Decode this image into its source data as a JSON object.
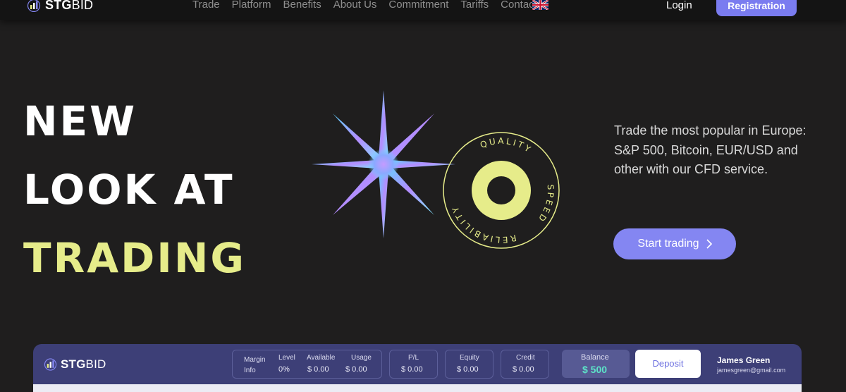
{
  "header": {
    "logo_text_bold": "STG",
    "logo_text_rest": "BID",
    "nav": [
      "Trade",
      "Platform",
      "Benefits",
      "About Us",
      "Commitment",
      "Tariffs",
      "Contacts"
    ],
    "login": "Login",
    "register": "Registration"
  },
  "hero": {
    "line1": "NEW",
    "line2": "LOOK AT",
    "line3": "TRADING",
    "seal_words": [
      "QUALITY",
      "SPEED",
      "RELIABILITY"
    ],
    "description": "Trade the most popular in Europe: S&P 500, Bitcoin, EUR/USD and other with our CFD service.",
    "cta": "Start trading",
    "accent_color": "#e6ec8a",
    "button_color": "#8486f2"
  },
  "panel": {
    "logo_bold": "STG",
    "logo_rest": "BID",
    "margin_info_line1": "Margin",
    "margin_info_line2": "Info",
    "level_label": "Level",
    "level_value": "0%",
    "available_label": "Available",
    "available_value": "$ 0.00",
    "usage_label": "Usage",
    "usage_value": "$ 0.00",
    "pl_label": "P/L",
    "pl_value": "$ 0.00",
    "equity_label": "Equity",
    "equity_value": "$ 0.00",
    "credit_label": "Credit",
    "credit_value": "$ 0.00",
    "balance_label": "Balance",
    "balance_value": "$ 500",
    "deposit": "Deposit",
    "user_name": "James Green",
    "user_email": "jamesgreen@gmail.com"
  }
}
